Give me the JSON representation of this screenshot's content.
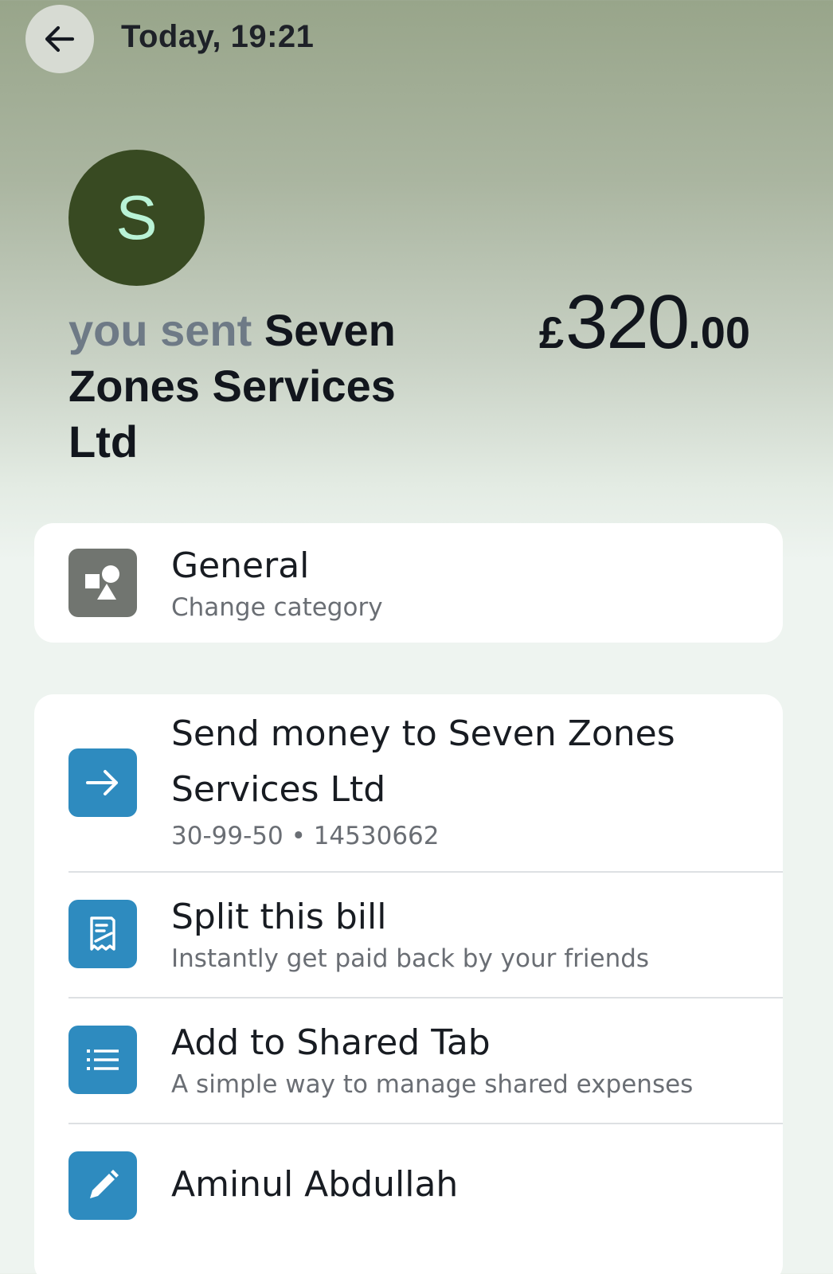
{
  "header": {
    "time": "Today, 19:21"
  },
  "payee": {
    "avatar_letter": "S",
    "prefix": "you sent",
    "name": "Seven Zones Services Ltd"
  },
  "amount": {
    "currency": "£",
    "major": "320",
    "minor": ".00"
  },
  "category": {
    "title": "General",
    "subtitle": "Change category"
  },
  "actions": [
    {
      "title_line1": "Send money to Seven Zones",
      "title_line2": "Services Ltd",
      "subtitle": "30-99-50 • 14530662",
      "icon": "arrow-right-icon"
    },
    {
      "title": "Split this bill",
      "subtitle": "Instantly get paid back by your friends",
      "icon": "receipt-icon"
    },
    {
      "title": "Add to Shared Tab",
      "subtitle": "A simple way to manage shared expenses",
      "icon": "list-icon"
    },
    {
      "title": "Aminul Abdullah",
      "icon": "pencil-icon"
    }
  ],
  "colors": {
    "avatar_bg": "#384a22",
    "avatar_text": "#b9f3d6",
    "action_icon_bg": "#2e8bbf",
    "category_icon_bg": "#717570"
  }
}
